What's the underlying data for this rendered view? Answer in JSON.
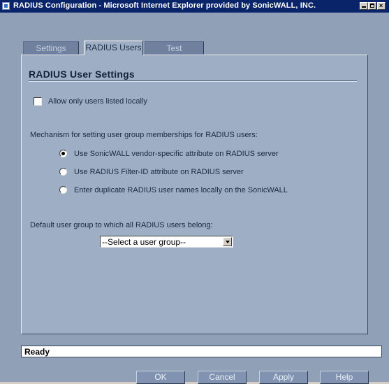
{
  "window": {
    "title": "RADIUS Configuration - Microsoft Internet Explorer provided by SonicWALL, INC."
  },
  "tabs": [
    {
      "label": "Settings",
      "active": false
    },
    {
      "label": "RADIUS Users",
      "active": true
    },
    {
      "label": "Test",
      "active": false
    }
  ],
  "panel": {
    "title": "RADIUS User Settings",
    "allow_local": {
      "label": "Allow only users listed locally",
      "checked": false
    },
    "mechanism_label": "Mechanism for setting user group memberships for RADIUS users:",
    "radios": [
      {
        "label": "Use SonicWALL vendor-specific attribute on RADIUS server",
        "selected": true
      },
      {
        "label": "Use RADIUS Filter-ID attribute on RADIUS server",
        "selected": false
      },
      {
        "label": "Enter duplicate RADIUS user names locally on the SonicWALL",
        "selected": false
      }
    ],
    "default_group_label": "Default user group to which all RADIUS users belong:",
    "group_select": {
      "value": "--Select a user group--"
    }
  },
  "status": {
    "text": "Ready"
  },
  "buttons": {
    "ok": "OK",
    "cancel": "Cancel",
    "apply": "Apply",
    "help": "Help"
  },
  "colors": {
    "title_bar": "#0a246a",
    "window_bg": "#8fa0b7",
    "panel_bg": "#9eaec4"
  }
}
